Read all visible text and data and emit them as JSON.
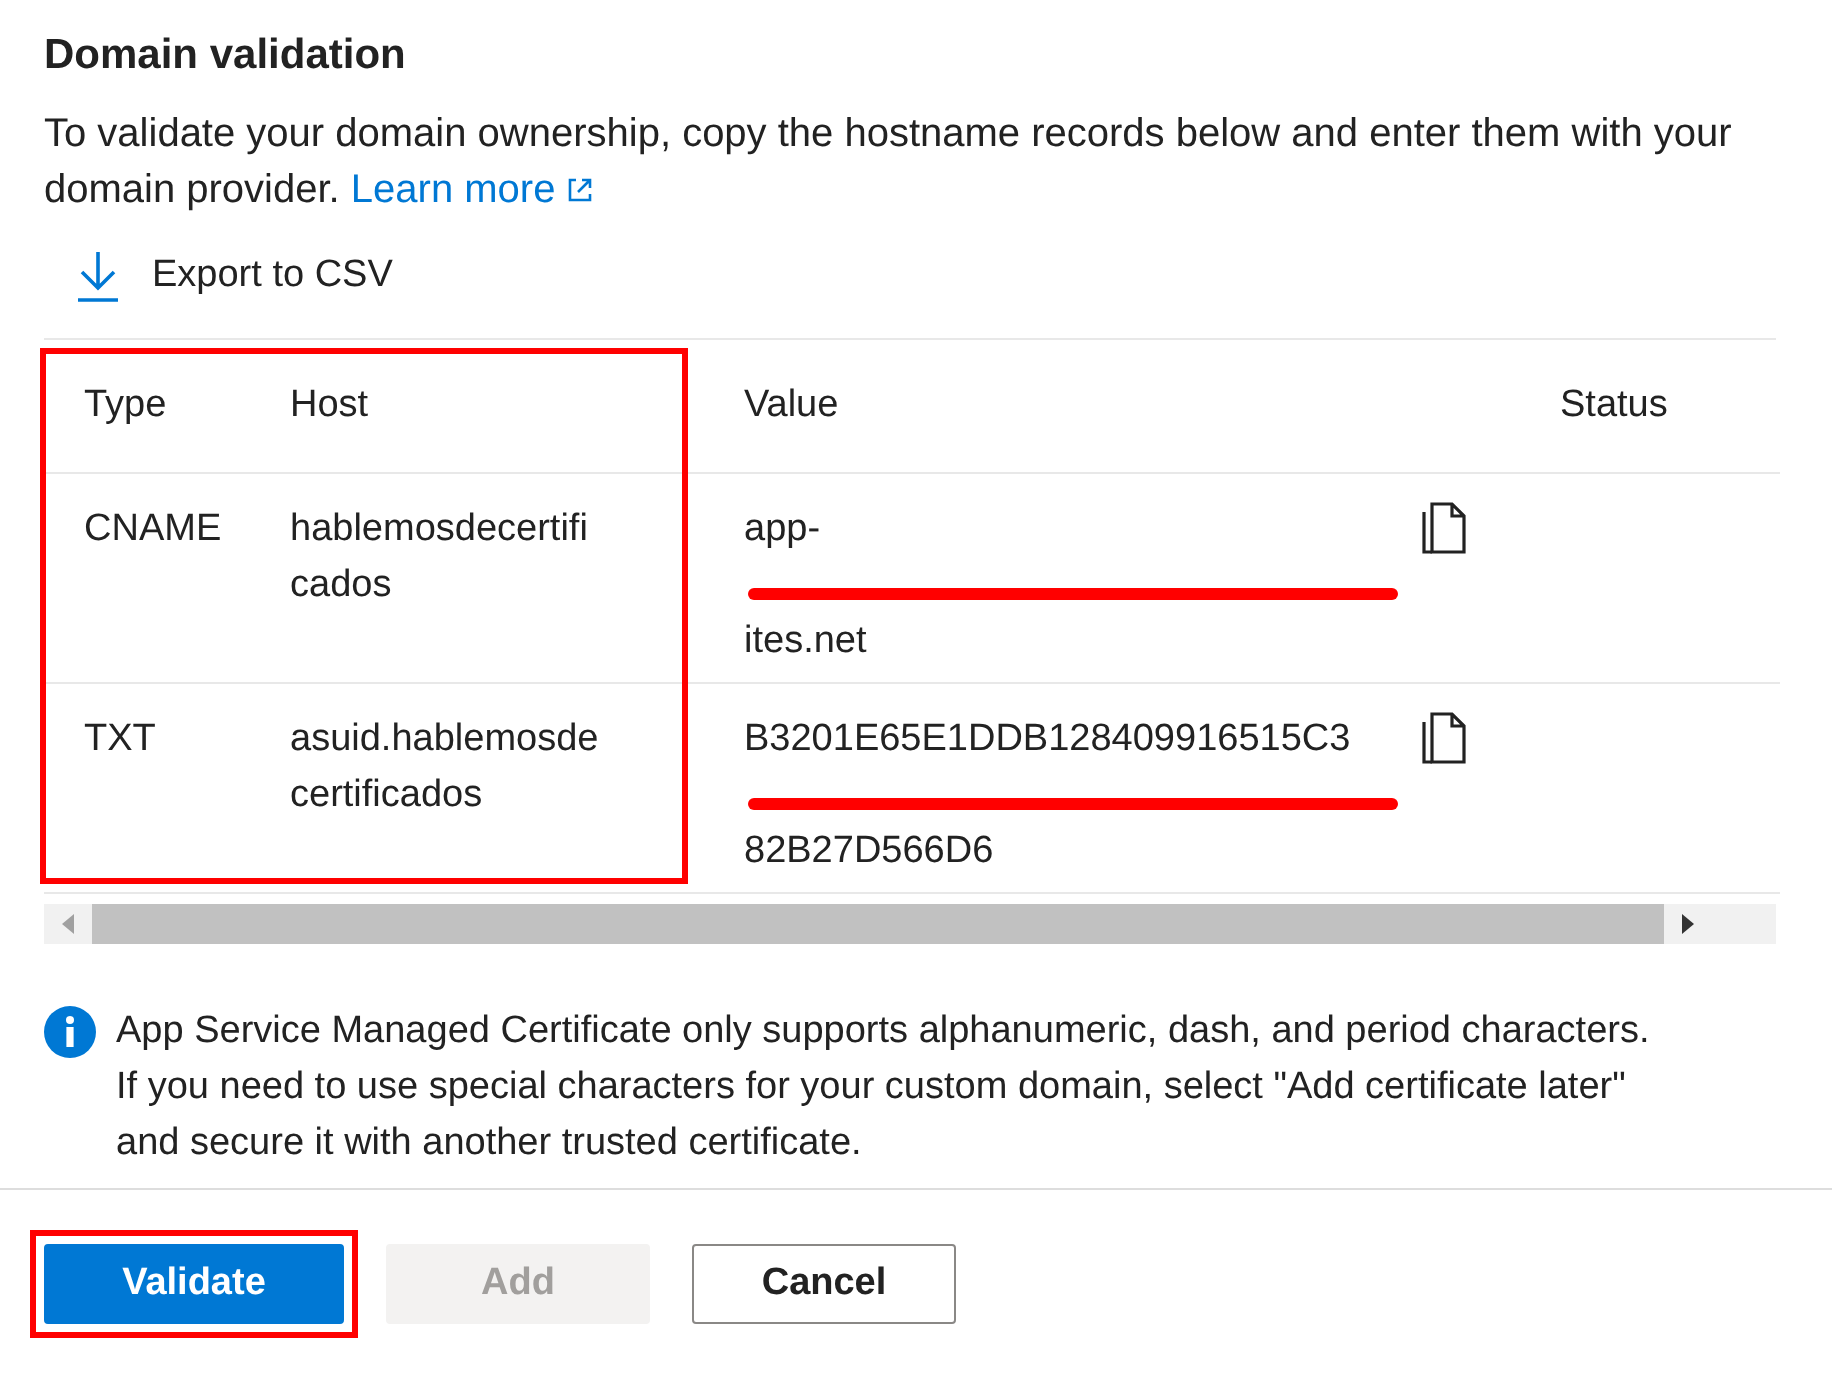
{
  "title": "Domain validation",
  "description": {
    "text": "To validate your domain ownership, copy the hostname records below and enter them with your domain provider.",
    "link": "Learn more"
  },
  "export": {
    "label": "Export to CSV"
  },
  "table": {
    "highlight_first_columns": true,
    "columns": [
      "Type",
      "Host",
      "Value",
      "Status"
    ],
    "rows": [
      {
        "type": "CNAME",
        "host": [
          "hablemosdecertifi",
          "cados"
        ],
        "value": [
          {
            "text": "app-",
            "redacted": false
          },
          {
            "redacted": true
          },
          {
            "text": "ites.net",
            "redacted": false
          }
        ]
      },
      {
        "type": "TXT",
        "host": [
          "asuid.hablemosde",
          "certificados"
        ],
        "value": [
          {
            "text": "B3201E65E1DDB128409916515C3",
            "redacted": false
          },
          {
            "redacted": true
          },
          {
            "text": "82B27D566D6",
            "redacted": false
          }
        ]
      }
    ]
  },
  "info": "App Service Managed Certificate only supports alphanumeric, dash, and period characters. If you need to use special characters for your custom domain, select \"Add certificate later\" and secure it with another trusted certificate.",
  "buttons": [
    {
      "label": "Validate",
      "kind": "primary",
      "disabled": false,
      "highlighted": true
    },
    {
      "label": "Add",
      "kind": "default",
      "disabled": true,
      "highlighted": false
    },
    {
      "label": "Cancel",
      "kind": "default",
      "disabled": false,
      "highlighted": false
    }
  ]
}
